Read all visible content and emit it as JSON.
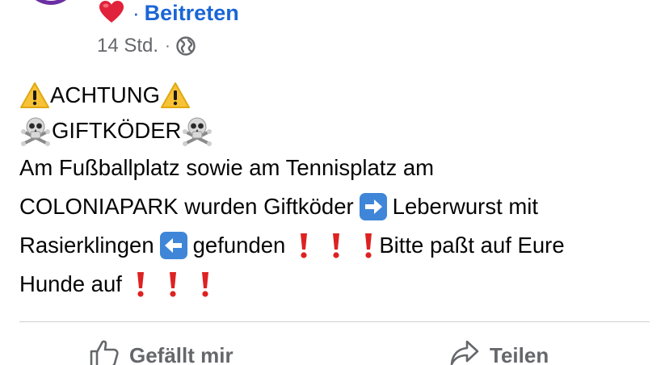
{
  "group": {
    "join_label": "Beitreten",
    "separator": "·",
    "reaction_icon": "red-heart-icon"
  },
  "meta": {
    "time": "14 Std.",
    "separator": "·",
    "audience_icon": "globe-icon"
  },
  "post": {
    "line1_text": "ACHTUNG",
    "line2_text": "GIFTKÖDER",
    "line3_text": "Am Fußballplatz sowie am Tennisplatz am",
    "line4_text_a": "COLONIAPARK wurden Giftköder",
    "line4_text_b": "Leberwurst mit",
    "line5_text_a": "Rasierklingen",
    "line5_text_b": "gefunden",
    "line5_text_c": "Bitte paßt auf Eure",
    "line6_text": "Hunde auf",
    "emoji": {
      "warning": "warning-sign",
      "skull": "skull-and-crossbones",
      "right_arrow": "right-arrow-box",
      "left_arrow": "left-arrow-box",
      "exclamation": "red-exclamation-mark"
    }
  },
  "actions": {
    "like_label": "Gefällt mir",
    "share_label": "Teilen"
  },
  "colors": {
    "link_blue": "#1a66d6",
    "meta_gray": "#65676b",
    "text": "#050505",
    "divider": "#ced0d4",
    "avatar_ring": "#6b2fa3",
    "heart_red": "#e0223a",
    "exclamation_red": "#dd2222",
    "arrow_box_blue": "#3f86d8"
  }
}
